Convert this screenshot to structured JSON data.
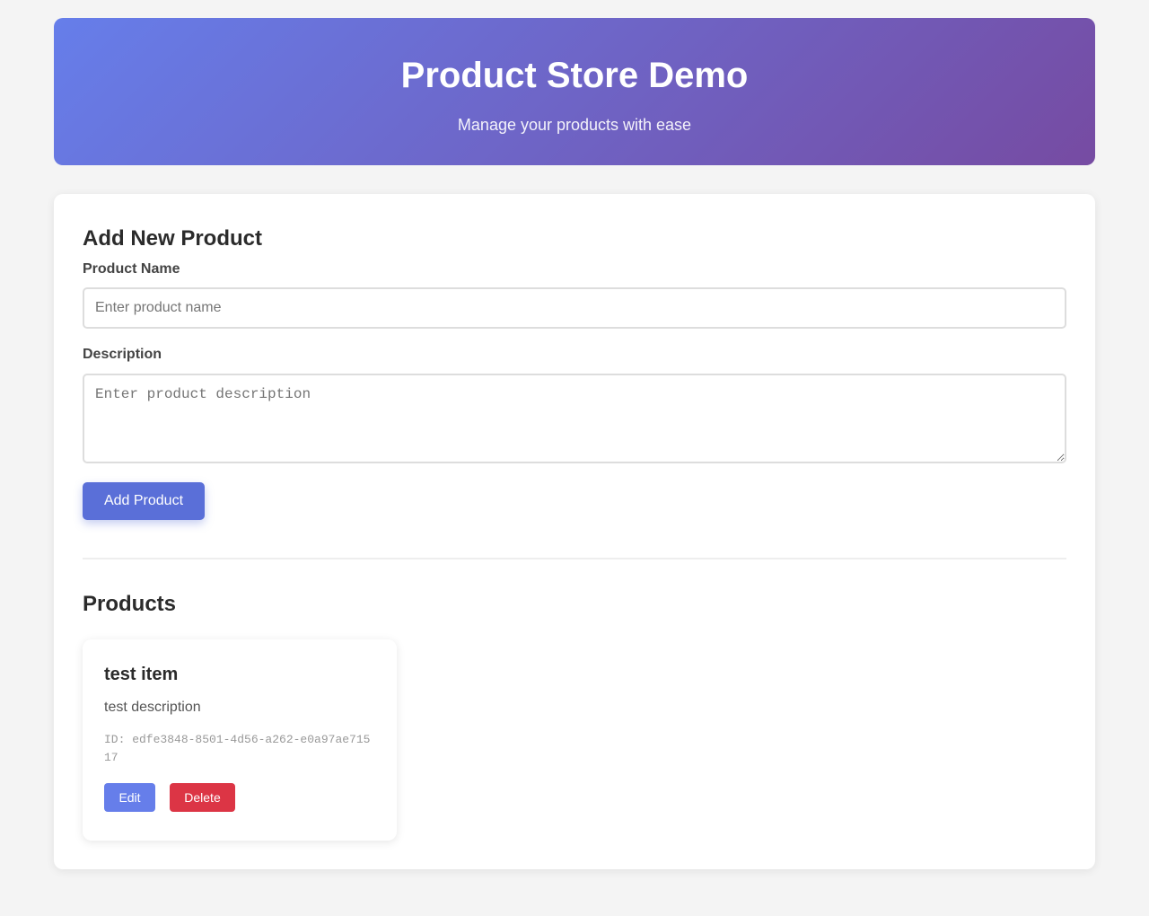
{
  "header": {
    "title": "Product Store Demo",
    "subtitle": "Manage your products with ease",
    "gradient_start": "#667eea",
    "gradient_end": "#764ba2"
  },
  "form": {
    "heading": "Add New Product",
    "name_label": "Product Name",
    "name_placeholder": "Enter product name",
    "name_value": "",
    "description_label": "Description",
    "description_placeholder": "Enter product description",
    "description_value": "",
    "submit_label": "Add Product",
    "accent_color": "#5a6fd8"
  },
  "products": {
    "heading": "Products",
    "items": [
      {
        "name": "test item",
        "description": "test description",
        "id_text": "ID: edfe3848-8501-4d56-a262-e0a97ae71517",
        "edit_label": "Edit",
        "delete_label": "Delete",
        "edit_color": "#667eea",
        "delete_color": "#dc3545"
      }
    ]
  }
}
